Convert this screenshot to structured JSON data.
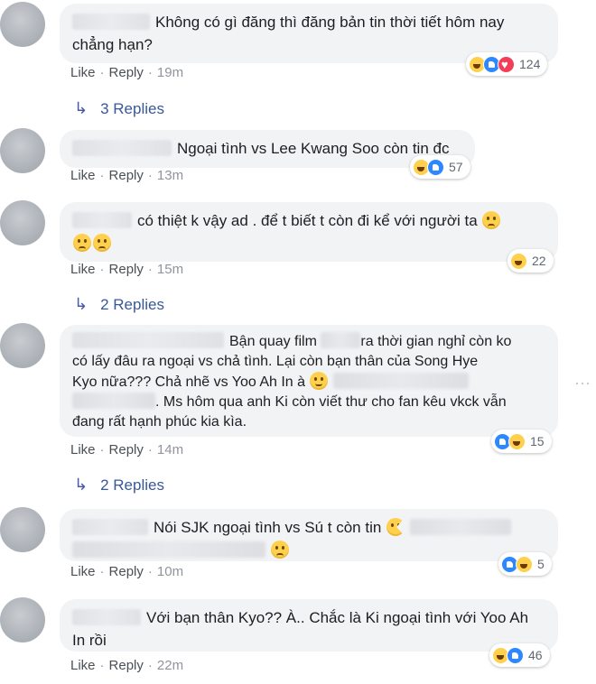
{
  "comments": [
    {
      "text_lines": [
        "Không có gì đăng thì đăng bản tin thời tiết hôm nay",
        "chẳng hạn?"
      ],
      "like": "Like",
      "reply": "Reply",
      "time": "19m",
      "reactions": [
        "haha",
        "like",
        "love"
      ],
      "reaction_count": "124",
      "replies_label": "3 Replies"
    },
    {
      "text_lines": [
        "Ngoại tình vs Lee Kwang Soo còn tin đc"
      ],
      "like": "Like",
      "reply": "Reply",
      "time": "13m",
      "reactions": [
        "haha",
        "like"
      ],
      "reaction_count": "57"
    },
    {
      "text_lines": [
        "có thiệt k vậy ad . để t biết t còn đi kể với người ta"
      ],
      "like": "Like",
      "reply": "Reply",
      "time": "15m",
      "reactions": [
        "haha"
      ],
      "reaction_count": "22",
      "replies_label": "2 Replies"
    },
    {
      "text_lines": [
        "Bận quay film",
        "ra thời gian nghỉ còn ko",
        "có lấy đâu ra ngoại vs chả tình. Lại còn bạn thân của Song Hye",
        "Kyo nữa??? Chả nhẽ vs Yoo Ah In à",
        ". Ms hôm qua anh Ki còn viết thư cho fan kêu vkck vẫn",
        "đang rất hạnh phúc kia kìa."
      ],
      "like": "Like",
      "reply": "Reply",
      "time": "14m",
      "reactions": [
        "like",
        "haha"
      ],
      "reaction_count": "15",
      "replies_label": "2 Replies"
    },
    {
      "text_lines": [
        "Nói SJK ngoại tình vs Sú t còn tin"
      ],
      "like": "Like",
      "reply": "Reply",
      "time": "10m",
      "reactions": [
        "like",
        "haha"
      ],
      "reaction_count": "5"
    },
    {
      "text_lines": [
        "Với bạn thân Kyo?? À.. Chắc là Ki ngoại tình với Yoo Ah",
        "In rồi"
      ],
      "like": "Like",
      "reply": "Reply",
      "time": "22m",
      "reactions": [
        "haha",
        "like"
      ],
      "reaction_count": "46"
    }
  ],
  "more_icon": "more-options-icon",
  "colors": {
    "link": "#385898",
    "bubble": "#f2f3f5",
    "meta": "#90949c"
  }
}
